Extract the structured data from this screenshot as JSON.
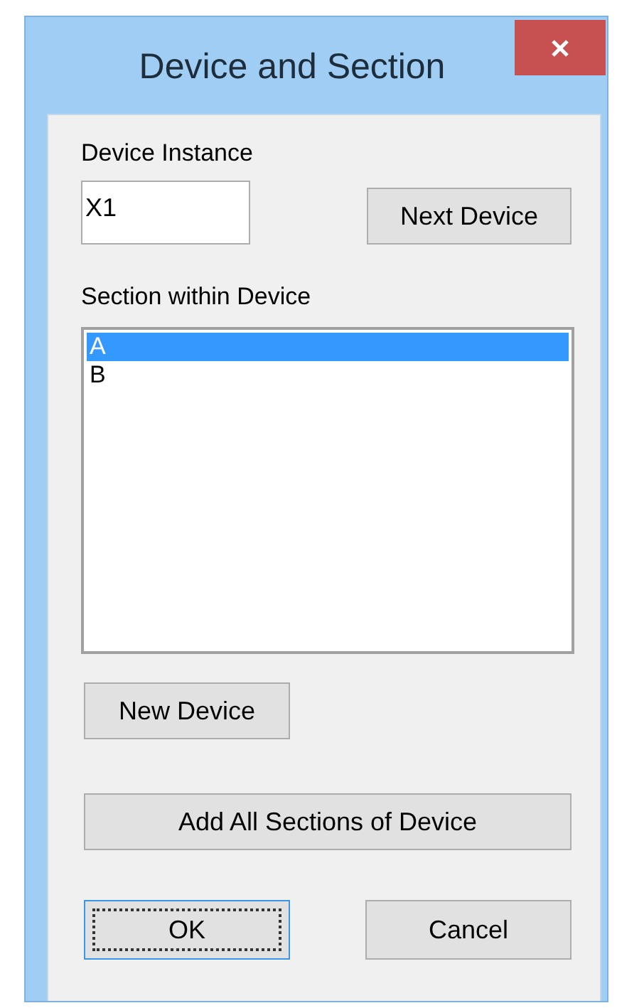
{
  "window": {
    "title": "Device and Section"
  },
  "device_instance": {
    "label": "Device Instance",
    "value": "X1"
  },
  "next_device_button": "Next Device",
  "section_list": {
    "label": "Section within Device",
    "items": [
      {
        "text": "A",
        "selected": true
      },
      {
        "text": "B",
        "selected": false
      }
    ]
  },
  "new_device_button": "New Device",
  "add_all_button": "Add All Sections of Device",
  "dialog_buttons": [
    {
      "label": "OK",
      "focused": true
    },
    {
      "label": "Cancel",
      "focused": false
    }
  ]
}
